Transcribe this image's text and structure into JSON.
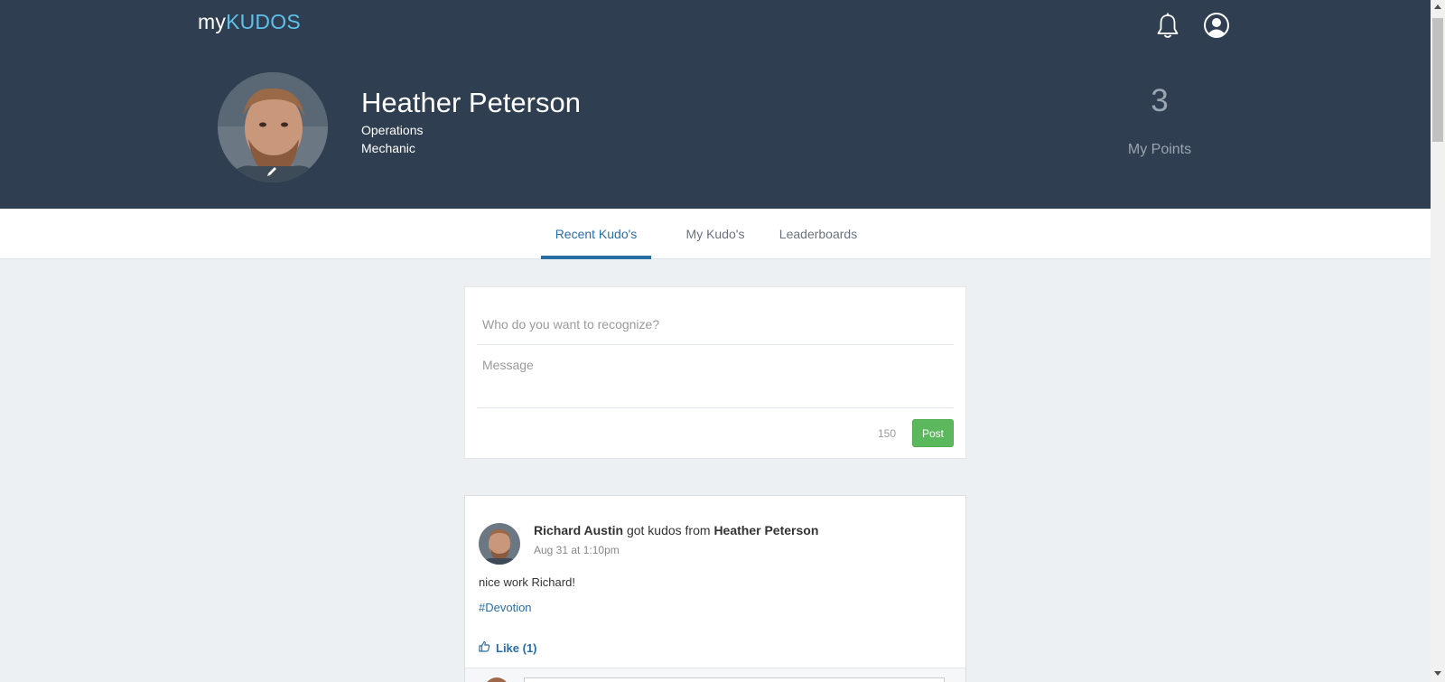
{
  "header": {
    "logo_prefix": "my",
    "logo_accent": "KUDOS",
    "notification_icon": "bell-icon",
    "user_icon": "user-icon"
  },
  "profile": {
    "name": "Heather Peterson",
    "department": "Operations",
    "role": "Mechanic",
    "points": "3",
    "points_label": "My Points"
  },
  "tabs": [
    {
      "label": "Recent Kudo's",
      "active": true
    },
    {
      "label": "My Kudo's",
      "active": false
    },
    {
      "label": "Leaderboards",
      "active": false
    }
  ],
  "compose": {
    "recipient_placeholder": "Who do you want to recognize?",
    "message_placeholder": "Message",
    "char_count": "150",
    "post_label": "Post"
  },
  "feed": [
    {
      "recipient": "Richard Austin",
      "action": "got kudos from",
      "sender": "Heather Peterson",
      "time": "Aug 31 at 1:10pm",
      "message": "nice work Richard!",
      "tag": "#Devotion",
      "like_label": "Like (1)"
    }
  ],
  "colors": {
    "header_bg": "#2f3e50",
    "accent": "#5fc0ea",
    "link": "#2a6ea6",
    "post_button": "#5cb85c",
    "page_bg": "#ecf0f3"
  }
}
